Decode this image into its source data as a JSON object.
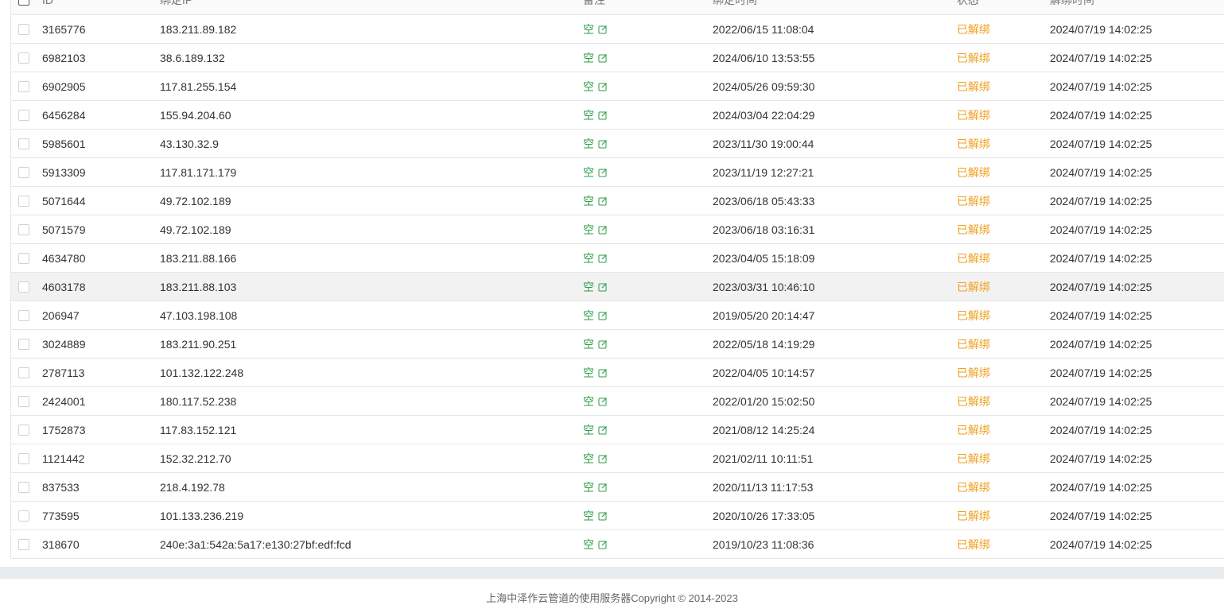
{
  "table": {
    "headers": {
      "id": "ID",
      "ip": "绑定IP",
      "note": "备注",
      "bind_time": "绑定时间",
      "status": "状态",
      "unbind_time": "解绑时间"
    },
    "rows": [
      {
        "id": "3165776",
        "ip": "183.211.89.182",
        "note": "空",
        "bind_time": "2022/06/15 11:08:04",
        "status": "已解绑",
        "unbind_time": "2024/07/19 14:02:25"
      },
      {
        "id": "6982103",
        "ip": "38.6.189.132",
        "note": "空",
        "bind_time": "2024/06/10 13:53:55",
        "status": "已解绑",
        "unbind_time": "2024/07/19 14:02:25"
      },
      {
        "id": "6902905",
        "ip": "117.81.255.154",
        "note": "空",
        "bind_time": "2024/05/26 09:59:30",
        "status": "已解绑",
        "unbind_time": "2024/07/19 14:02:25"
      },
      {
        "id": "6456284",
        "ip": "155.94.204.60",
        "note": "空",
        "bind_time": "2024/03/04 22:04:29",
        "status": "已解绑",
        "unbind_time": "2024/07/19 14:02:25"
      },
      {
        "id": "5985601",
        "ip": "43.130.32.9",
        "note": "空",
        "bind_time": "2023/11/30 19:00:44",
        "status": "已解绑",
        "unbind_time": "2024/07/19 14:02:25"
      },
      {
        "id": "5913309",
        "ip": "117.81.171.179",
        "note": "空",
        "bind_time": "2023/11/19 12:27:21",
        "status": "已解绑",
        "unbind_time": "2024/07/19 14:02:25"
      },
      {
        "id": "5071644",
        "ip": "49.72.102.189",
        "note": "空",
        "bind_time": "2023/06/18 05:43:33",
        "status": "已解绑",
        "unbind_time": "2024/07/19 14:02:25"
      },
      {
        "id": "5071579",
        "ip": "49.72.102.189",
        "note": "空",
        "bind_time": "2023/06/18 03:16:31",
        "status": "已解绑",
        "unbind_time": "2024/07/19 14:02:25"
      },
      {
        "id": "4634780",
        "ip": "183.211.88.166",
        "note": "空",
        "bind_time": "2023/04/05 15:18:09",
        "status": "已解绑",
        "unbind_time": "2024/07/19 14:02:25"
      },
      {
        "id": "4603178",
        "ip": "183.211.88.103",
        "note": "空",
        "bind_time": "2023/03/31 10:46:10",
        "status": "已解绑",
        "unbind_time": "2024/07/19 14:02:25"
      },
      {
        "id": "206947",
        "ip": "47.103.198.108",
        "note": "空",
        "bind_time": "2019/05/20 20:14:47",
        "status": "已解绑",
        "unbind_time": "2024/07/19 14:02:25"
      },
      {
        "id": "3024889",
        "ip": "183.211.90.251",
        "note": "空",
        "bind_time": "2022/05/18 14:19:29",
        "status": "已解绑",
        "unbind_time": "2024/07/19 14:02:25"
      },
      {
        "id": "2787113",
        "ip": "101.132.122.248",
        "note": "空",
        "bind_time": "2022/04/05 10:14:57",
        "status": "已解绑",
        "unbind_time": "2024/07/19 14:02:25"
      },
      {
        "id": "2424001",
        "ip": "180.117.52.238",
        "note": "空",
        "bind_time": "2022/01/20 15:02:50",
        "status": "已解绑",
        "unbind_time": "2024/07/19 14:02:25"
      },
      {
        "id": "1752873",
        "ip": "117.83.152.121",
        "note": "空",
        "bind_time": "2021/08/12 14:25:24",
        "status": "已解绑",
        "unbind_time": "2024/07/19 14:02:25"
      },
      {
        "id": "1121442",
        "ip": "152.32.212.70",
        "note": "空",
        "bind_time": "2021/02/11 10:11:51",
        "status": "已解绑",
        "unbind_time": "2024/07/19 14:02:25"
      },
      {
        "id": "837533",
        "ip": "218.4.192.78",
        "note": "空",
        "bind_time": "2020/11/13 11:17:53",
        "status": "已解绑",
        "unbind_time": "2024/07/19 14:02:25"
      },
      {
        "id": "773595",
        "ip": "101.133.236.219",
        "note": "空",
        "bind_time": "2020/10/26 17:33:05",
        "status": "已解绑",
        "unbind_time": "2024/07/19 14:02:25"
      },
      {
        "id": "318670",
        "ip": "240e:3a1:542a:5a17:e130:27bf:edf:fcd",
        "note": "空",
        "bind_time": "2019/10/23 11:08:36",
        "status": "已解绑",
        "unbind_time": "2024/07/19 14:02:25"
      }
    ]
  },
  "footer": {
    "copyright": "上海中泽作云管道的使用服务器Copyright © 2014-2023"
  },
  "colors": {
    "note_green": "#2e9e48",
    "status_orange": "#f0a020"
  },
  "icons": {
    "edit": "edit-icon"
  }
}
